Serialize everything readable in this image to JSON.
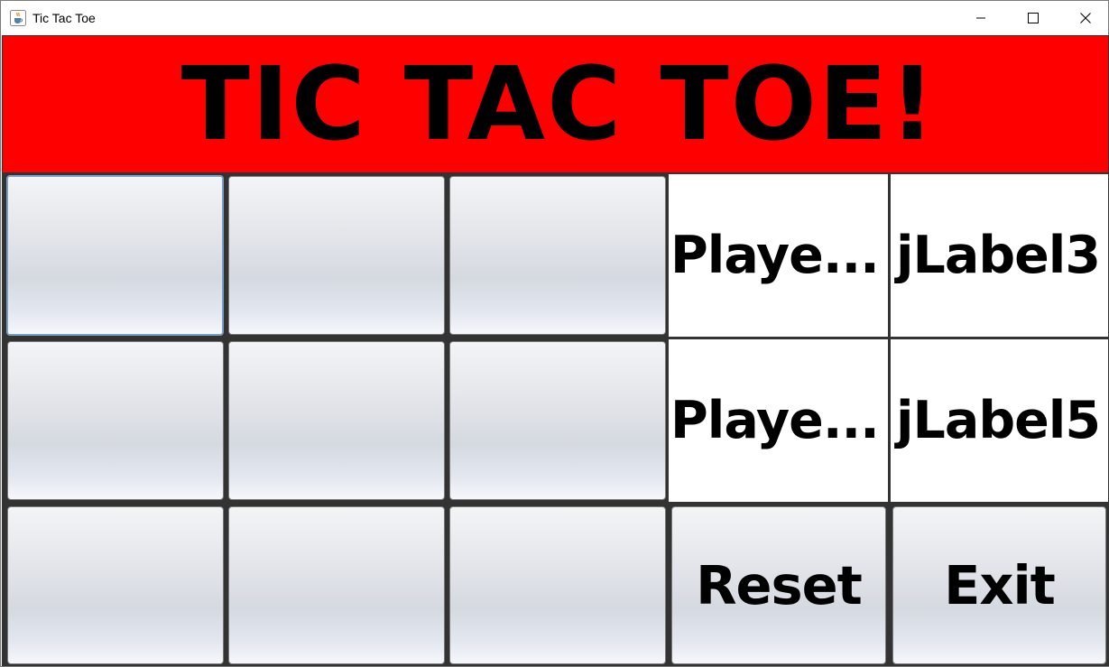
{
  "window": {
    "title": "Tic Tac Toe",
    "icon": "java-cup-icon",
    "controls": [
      "minimize-icon",
      "maximize-icon",
      "close-icon"
    ]
  },
  "header": {
    "title": "TIC TAC TOE!",
    "background": "#ff0000"
  },
  "board": {
    "cells": [
      "",
      "",
      "",
      "",
      "",
      "",
      "",
      "",
      ""
    ]
  },
  "labels": {
    "player1_label": "Playe...",
    "player1_value": "jLabel3",
    "player2_label": "Playe...",
    "player2_value": "jLabel5"
  },
  "buttons": {
    "reset": "Reset",
    "exit": "Exit"
  }
}
